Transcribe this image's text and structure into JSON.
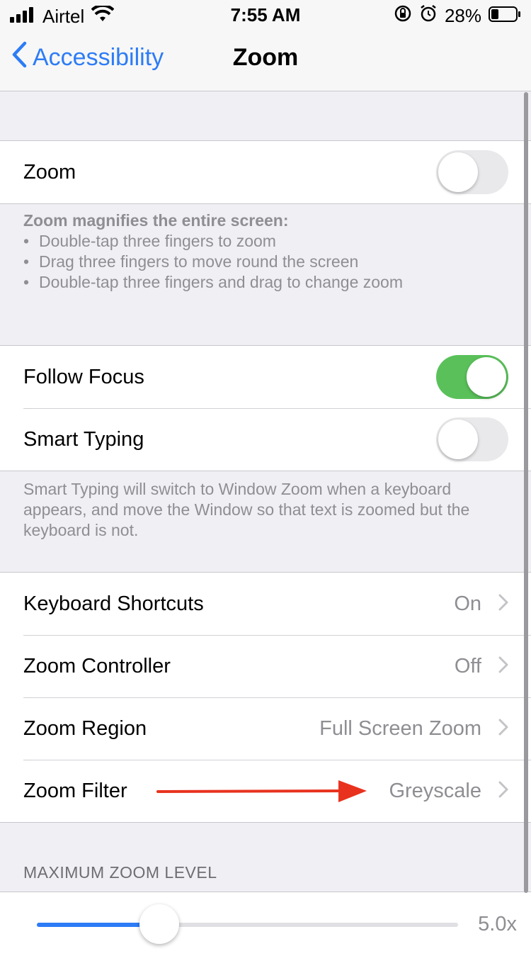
{
  "status_bar": {
    "carrier": "Airtel",
    "time": "7:55 AM",
    "battery_percent": "28%",
    "battery_level": 0.28,
    "icons": [
      "signal-icon",
      "wifi-icon",
      "orientation-lock-icon",
      "alarm-icon",
      "battery-icon"
    ]
  },
  "nav": {
    "back_label": "Accessibility",
    "title": "Zoom"
  },
  "zoom_group": {
    "label": "Zoom",
    "enabled": false
  },
  "zoom_footer": {
    "heading": "Zoom magnifies the entire screen:",
    "bullets": [
      "Double-tap three fingers to zoom",
      "Drag three fingers to move round the screen",
      "Double-tap three fingers and drag to change zoom"
    ],
    "bullet_char": "•"
  },
  "focus_group": {
    "follow_focus": {
      "label": "Follow Focus",
      "enabled": true
    },
    "smart_typing": {
      "label": "Smart Typing",
      "enabled": false
    }
  },
  "smart_typing_footer": "Smart Typing will switch to Window Zoom when a keyboard appears, and move the Window so that text is zoomed but the keyboard is not.",
  "options_group": {
    "items": [
      {
        "label": "Keyboard Shortcuts",
        "value": "On"
      },
      {
        "label": "Zoom Controller",
        "value": "Off"
      },
      {
        "label": "Zoom Region",
        "value": "Full Screen Zoom"
      },
      {
        "label": "Zoom Filter",
        "value": "Greyscale"
      }
    ]
  },
  "max_zoom": {
    "header": "MAXIMUM ZOOM LEVEL",
    "value_label": "5.0x",
    "slider_fraction": 0.29
  },
  "colors": {
    "accent": "#2d7cf6",
    "toggle_on": "#5ac15a",
    "annotation_arrow": "#e8321e"
  }
}
